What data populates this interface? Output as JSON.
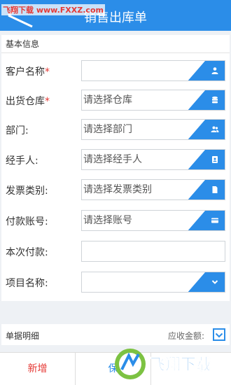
{
  "watermark": "飞翔下载 www.FXXZ.com",
  "header": {
    "title": "销售出库单",
    "back_icon": "back-arrow-icon",
    "color": "#2b8de8"
  },
  "basic_section": {
    "title": "基本信息"
  },
  "form": [
    {
      "label": "客户名称",
      "required": true,
      "placeholder": "",
      "icon": "person-icon"
    },
    {
      "label": "出货仓库",
      "required": true,
      "placeholder": "请选择仓库",
      "icon": "database-icon"
    },
    {
      "label": "部门:",
      "required": false,
      "placeholder": "请选择部门",
      "icon": "group-icon"
    },
    {
      "label": "经手人:",
      "required": false,
      "placeholder": "请选择经手人",
      "icon": "contact-card-icon"
    },
    {
      "label": "发票类别:",
      "required": false,
      "placeholder": "请选择发票类别",
      "icon": "document-icon"
    },
    {
      "label": "付款账号:",
      "required": false,
      "placeholder": "请选择账号",
      "icon": "credit-card-icon"
    },
    {
      "label": "本次付款:",
      "required": false,
      "placeholder": "",
      "icon": ""
    },
    {
      "label": "项目名称:",
      "required": false,
      "placeholder": "",
      "icon": "chevron-down-icon"
    }
  ],
  "detail": {
    "title": "单据明细",
    "amount_label": "应收金额:"
  },
  "bottom": {
    "new_label": "新增",
    "save_label": "保"
  },
  "logo_text": "飞翔下载",
  "colors": {
    "accent": "#2b8de8",
    "required": "#e53935"
  }
}
